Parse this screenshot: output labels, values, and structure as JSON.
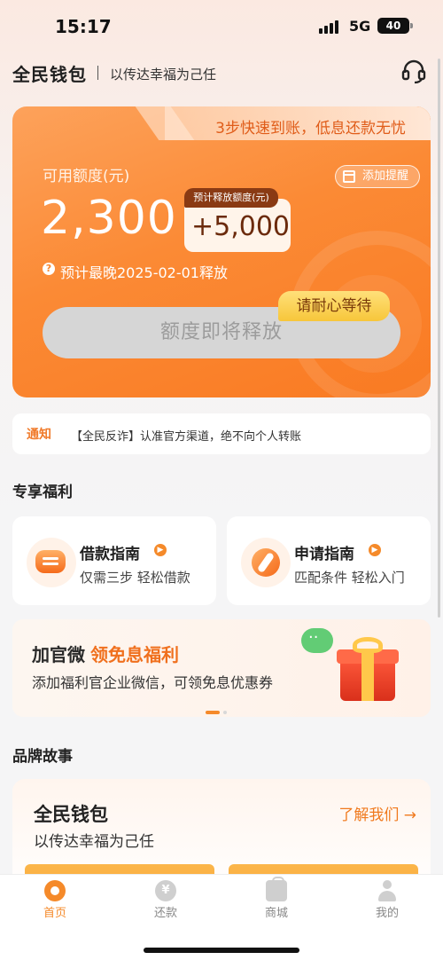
{
  "status_bar": {
    "time": "15:17",
    "network": "5G",
    "battery": "40"
  },
  "header": {
    "app_name": "全民钱包",
    "slogan": "以传达幸福为己任",
    "support_icon": "headset-icon"
  },
  "credit_card": {
    "tagline": "3步快速到账，低息还款无忧",
    "quota_label": "可用额度(元)",
    "quota_amount": "2,300",
    "remind_label": "添加提醒",
    "release_label": "预计释放额度(元)",
    "release_amount": "+5,000",
    "release_date": "预计最晚2025-02-01释放",
    "main_button": "额度即将释放",
    "wait_badge": "请耐心等待",
    "accent": "#f98a35"
  },
  "notice": {
    "tag": "通知",
    "text": "【全民反诈】认准官方渠道，绝不向个人转账"
  },
  "benefits": {
    "section_title": "专享福利",
    "items": [
      {
        "title": "借款指南",
        "subtitle": "仅需三步 轻松借款",
        "icon": "wallet-icon"
      },
      {
        "title": "申请指南",
        "subtitle": "匹配条件 轻松入门",
        "icon": "compass-icon"
      }
    ]
  },
  "banner": {
    "title": "加官微",
    "title_accent": "领免息福利",
    "subtitle": "添加福利官企业微信，可领免息优惠券",
    "page_index": 1,
    "page_count": 2
  },
  "brand": {
    "section_title": "品牌故事",
    "name": "全民钱包",
    "slogan": "以传达幸福为己任",
    "link": "了解我们 →"
  },
  "tab_bar": {
    "items": [
      {
        "label": "首页",
        "icon": "home-icon",
        "active": true
      },
      {
        "label": "还款",
        "icon": "yen-icon",
        "active": false
      },
      {
        "label": "商城",
        "icon": "shopping-bag-icon",
        "active": false
      },
      {
        "label": "我的",
        "icon": "user-icon",
        "active": false
      }
    ]
  }
}
